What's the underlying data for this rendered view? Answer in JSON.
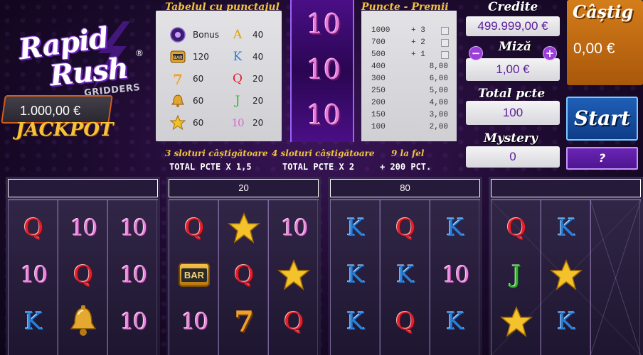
{
  "logo": {
    "line1": "Rapid",
    "line2": "Rush",
    "reg": "®",
    "sub": "GRIDDERS"
  },
  "jackpot": {
    "value": "1.000,00 €",
    "label": "JACKPOT"
  },
  "paytable": {
    "title": "Tabelul cu punctajul",
    "left": [
      {
        "icon": "bonus-icon",
        "value": "Bonus"
      },
      {
        "icon": "bar-icon",
        "value": "120"
      },
      {
        "icon": "seven-icon",
        "value": "60"
      },
      {
        "icon": "bell-icon",
        "value": "60"
      },
      {
        "icon": "star-icon",
        "value": "60"
      }
    ],
    "right": [
      {
        "symbol": "A",
        "value": "40"
      },
      {
        "symbol": "K",
        "value": "40"
      },
      {
        "symbol": "Q",
        "value": "20"
      },
      {
        "symbol": "J",
        "value": "20"
      },
      {
        "symbol": "10",
        "value": "20"
      }
    ]
  },
  "center_reel": [
    "10",
    "10",
    "10"
  ],
  "prizes": {
    "title": "Puncte - Premii",
    "rows": [
      {
        "points": "1000",
        "prize": "+ 3"
      },
      {
        "points": "700",
        "prize": "+ 2"
      },
      {
        "points": "500",
        "prize": "+ 1"
      },
      {
        "points": "400",
        "prize": "8,00"
      },
      {
        "points": "300",
        "prize": "6,00"
      },
      {
        "points": "250",
        "prize": "5,00"
      },
      {
        "points": "200",
        "prize": "4,00"
      },
      {
        "points": "150",
        "prize": "3,00"
      },
      {
        "points": "100",
        "prize": "2,00"
      }
    ]
  },
  "multipliers": [
    {
      "label": "3 sloturi câștigătoare",
      "value": "TOTAL PCTE X 1,5"
    },
    {
      "label": "4 sloturi câștigătoare",
      "value": "TOTAL PCTE X 2"
    },
    {
      "label": "9 la fel",
      "value": "+ 200 PCT."
    }
  ],
  "credits": {
    "label": "Credite",
    "value": "499.999,00 €"
  },
  "bet": {
    "label": "Miză",
    "value": "1,00 €",
    "minus": "−",
    "plus": "+"
  },
  "win": {
    "label": "Câștig",
    "value": "0,00 €"
  },
  "total_points": {
    "label": "Total pcte",
    "value": "100"
  },
  "mystery": {
    "label": "Mystery",
    "value": "0"
  },
  "start_label": "Start",
  "question_label": "?",
  "cards": [
    {
      "header": "",
      "columns": [
        [
          "Q",
          "10",
          "K"
        ],
        [
          "10",
          "Q",
          "bell"
        ],
        [
          "10",
          "10",
          "10"
        ]
      ]
    },
    {
      "header": "20",
      "columns": [
        [
          "Q",
          "BAR",
          "10"
        ],
        [
          "star",
          "Q",
          "7"
        ],
        [
          "10",
          "star",
          "Q"
        ]
      ]
    },
    {
      "header": "80",
      "columns": [
        [
          "K",
          "K",
          "K"
        ],
        [
          "Q",
          "K",
          "Q"
        ],
        [
          "K",
          "10",
          "K"
        ]
      ]
    },
    {
      "header": "",
      "columns": [
        [
          "Q",
          "J",
          "star"
        ],
        [
          "K",
          "star",
          "K"
        ],
        [
          "",
          "",
          ""
        ]
      ]
    }
  ]
}
